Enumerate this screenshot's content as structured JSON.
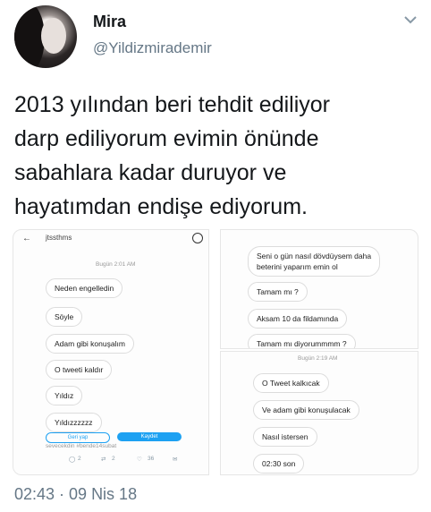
{
  "author": {
    "name": "Mira",
    "handle": "@Yildizmirademir"
  },
  "tweet": {
    "text": "2013 yılından beri tehdit ediliyor\ndarp ediliyorum evimin önünde\nsabahlara kadar duruyor ve\nhayatımdan endişe ediyorum.",
    "timestamp": "02:43 · 09 Nis 18"
  },
  "screenshot_left": {
    "header_title": "jtssthms",
    "day_label": "Bugün 2:01 AM",
    "messages": [
      "Neden engelledin",
      "Söyle",
      "Adam gibi konuşalım",
      "O tweeti kaldır",
      "Yıldız",
      "Yıldızzzzzz"
    ],
    "buttons": [
      "Geri yap",
      "Kaydet"
    ],
    "embedded_tweet_text": "sevecekdin #bende14subat",
    "stats": {
      "replies": "2",
      "retweets": "2",
      "likes": "36"
    }
  },
  "screenshot_right_top": {
    "messages": [
      "Seni o gün nasıl dövdüysem daha\nbeterini yaparım emin ol",
      "Tamam mı ?",
      "Aksam 10 da fildamında",
      "Tamam mı diyorummmm ?"
    ]
  },
  "screenshot_right_bottom": {
    "day_label": "Bugün 2:19 AM",
    "messages": [
      "O Tweet kalkıcak",
      "Ve adam gibi konuşulacak",
      "Nasıl istersen",
      "02:30 son"
    ]
  },
  "colors": {
    "accent": "#1da1f2",
    "muted": "#657786"
  },
  "icons": [
    "chevron-down-icon",
    "back-arrow-icon",
    "info-icon",
    "reply-icon",
    "retweet-icon",
    "like-icon",
    "mail-icon"
  ]
}
